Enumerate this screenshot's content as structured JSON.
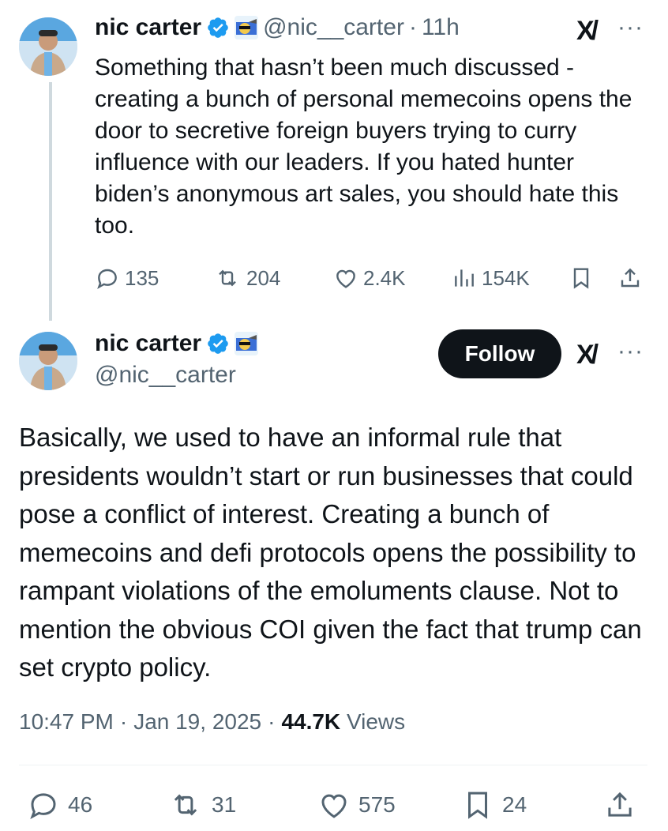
{
  "first_tweet": {
    "author_name": "nic carter",
    "handle": "@nic__carter",
    "separator": "·",
    "time_ago": "11h",
    "text": "Something that hasn’t been much discussed - creating a bunch of personal memecoins opens the door to secretive foreign buyers trying to curry influence with our leaders. If you hated hunter biden’s anonymous art sales, you should hate this too.",
    "replies": "135",
    "reposts": "204",
    "likes": "2.4K",
    "views": "154K"
  },
  "main_tweet": {
    "author_name": "nic carter",
    "handle": "@nic__carter",
    "follow_label": "Follow",
    "text": "Basically, we used to have an informal rule that presidents wouldn’t start or run businesses that could pose a conflict of interest. Creating a bunch of memecoins and defi protocols opens the possibility to rampant violations of the emoluments clause. Not to mention the obvious COI given the fact that trump can set crypto policy.",
    "time": "10:47 PM",
    "dot": "·",
    "date": "Jan 19, 2025",
    "views_count": "44.7K",
    "views_label": "Views",
    "replies": "46",
    "reposts": "31",
    "likes": "575",
    "bookmarks": "24"
  },
  "icons": {
    "grok": "grok-icon",
    "more": "more-icon",
    "verified_color": "#1d9bf0",
    "follow_bg": "#0f1419",
    "muted": "#536471"
  },
  "ui": {
    "grok_glyph": "X/",
    "more_glyph": "···"
  }
}
